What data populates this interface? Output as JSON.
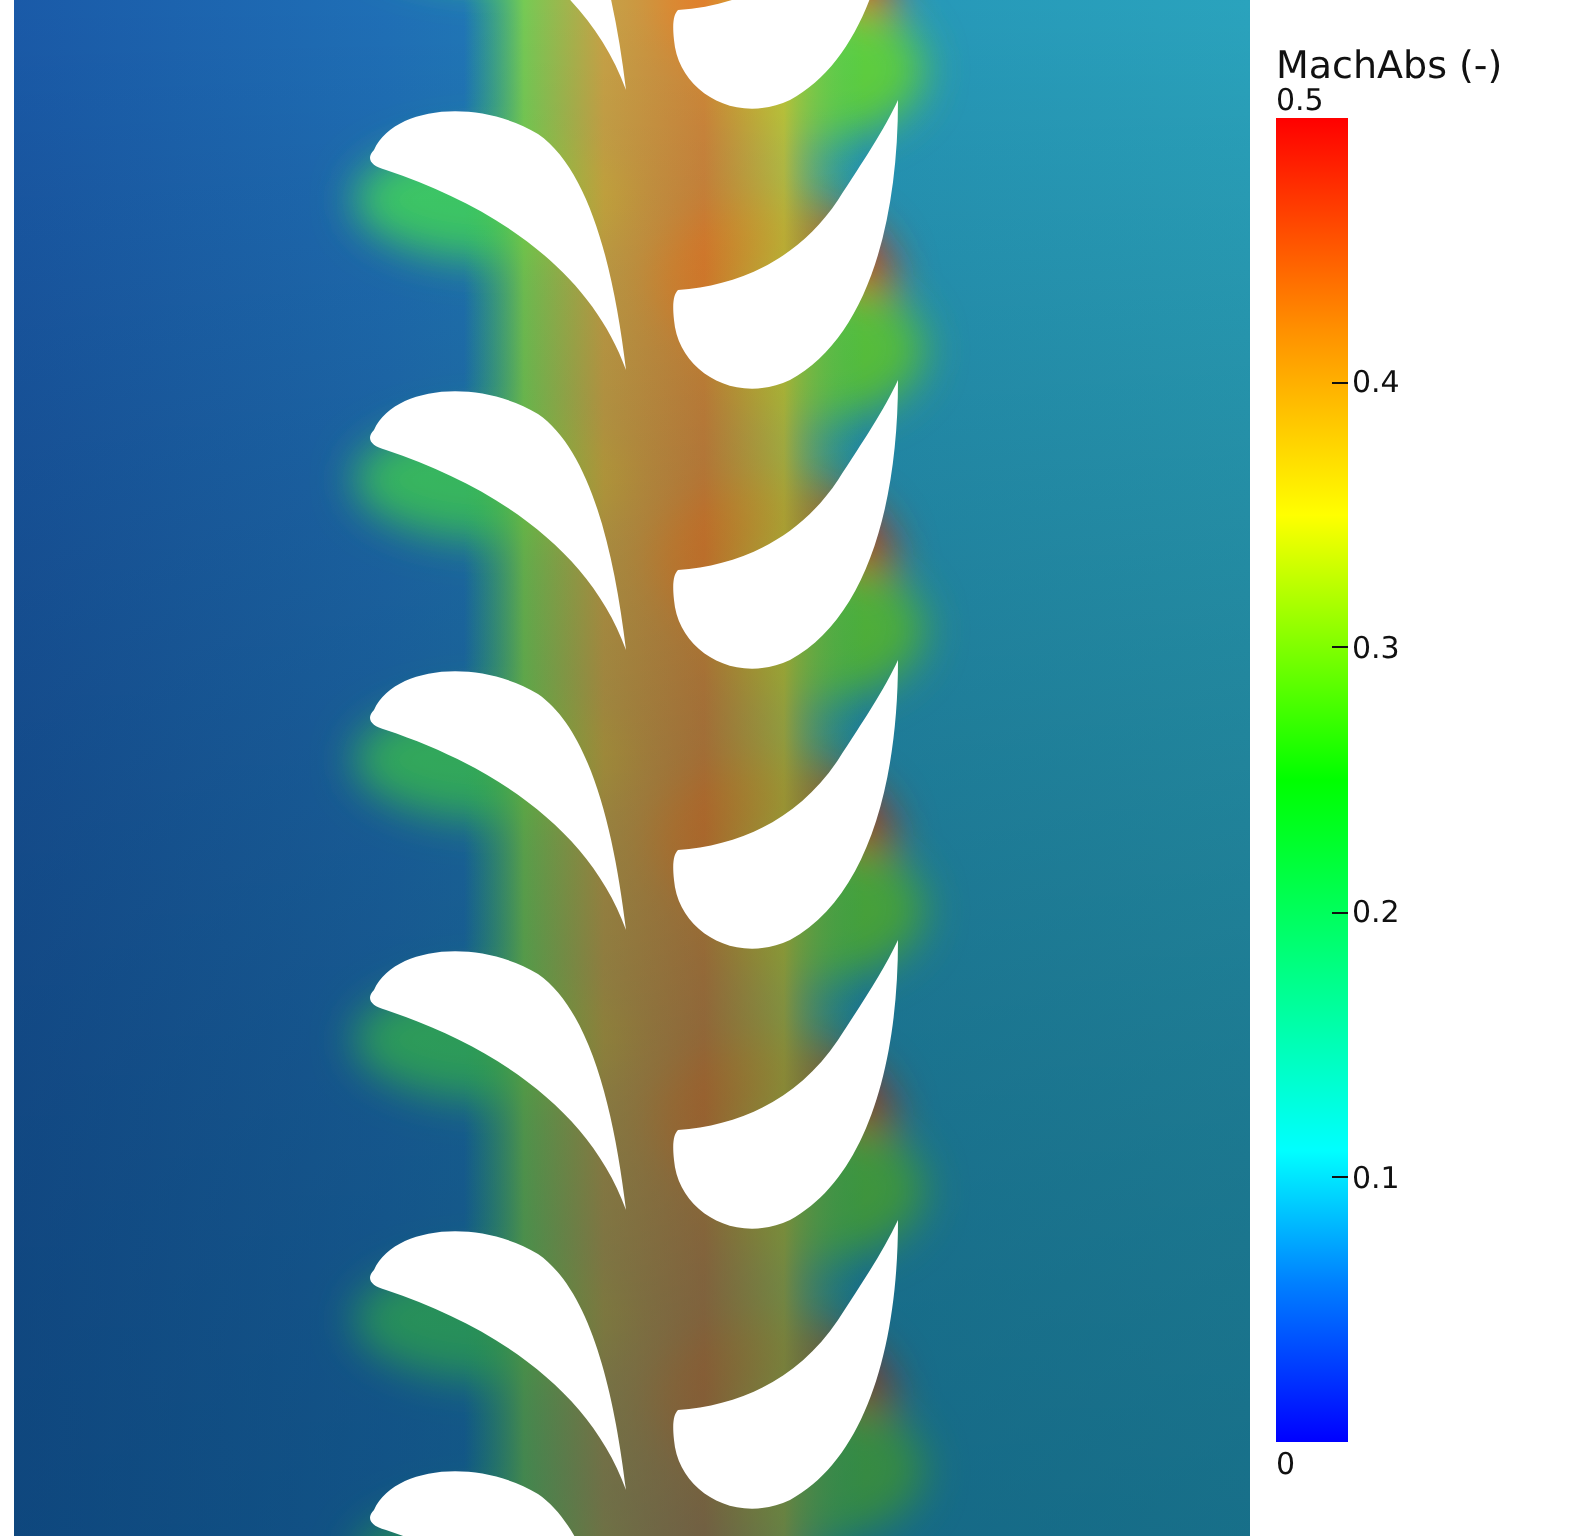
{
  "legend": {
    "title": "MachAbs (-)",
    "max_label": "0.5",
    "ticks": [
      "0.4",
      "0.3",
      "0.2",
      "0.1"
    ],
    "min_label": "0"
  }
}
